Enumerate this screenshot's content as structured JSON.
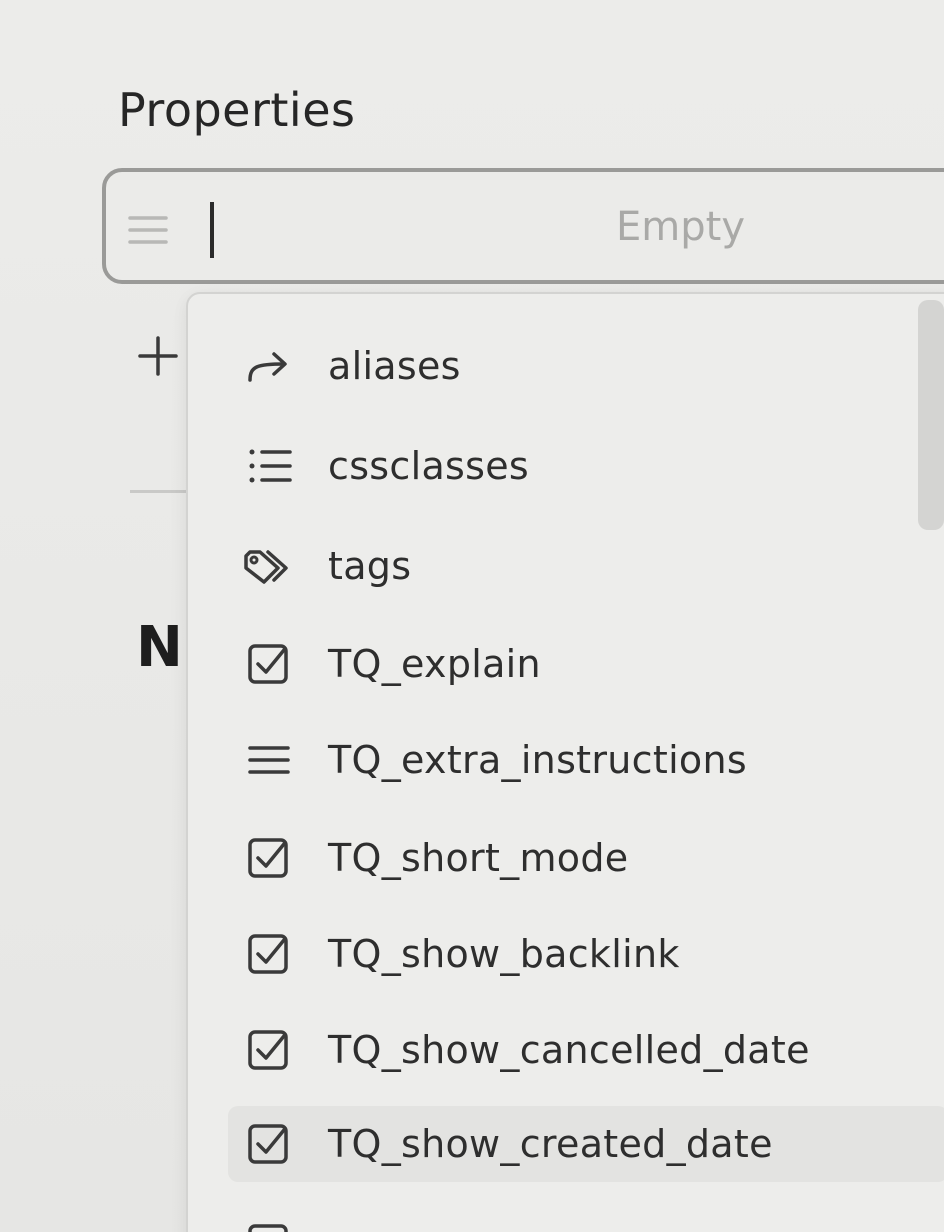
{
  "panel": {
    "title": "Properties"
  },
  "new_property": {
    "type_icon": "text-lines-icon",
    "name_value": "",
    "value_placeholder": "Empty"
  },
  "add_property": {
    "icon": "plus-icon"
  },
  "note_heading_partial": "N",
  "suggestions": {
    "items": [
      {
        "label": "aliases",
        "icon": "forward-arrow-icon"
      },
      {
        "label": "cssclasses",
        "icon": "list-icon"
      },
      {
        "label": "tags",
        "icon": "tags-icon"
      },
      {
        "label": "TQ_explain",
        "icon": "checkbox-icon"
      },
      {
        "label": "TQ_extra_instructions",
        "icon": "text-lines-icon"
      },
      {
        "label": "TQ_short_mode",
        "icon": "checkbox-icon"
      },
      {
        "label": "TQ_show_backlink",
        "icon": "checkbox-icon"
      },
      {
        "label": "TQ_show_cancelled_date",
        "icon": "checkbox-icon"
      },
      {
        "label": "TQ_show_created_date",
        "icon": "checkbox-icon",
        "selected": true
      }
    ]
  },
  "colors": {
    "background": "#e9e9e7",
    "text": "#2b2b2b",
    "placeholder": "#a9a9a7",
    "border": "#9a9a98"
  }
}
